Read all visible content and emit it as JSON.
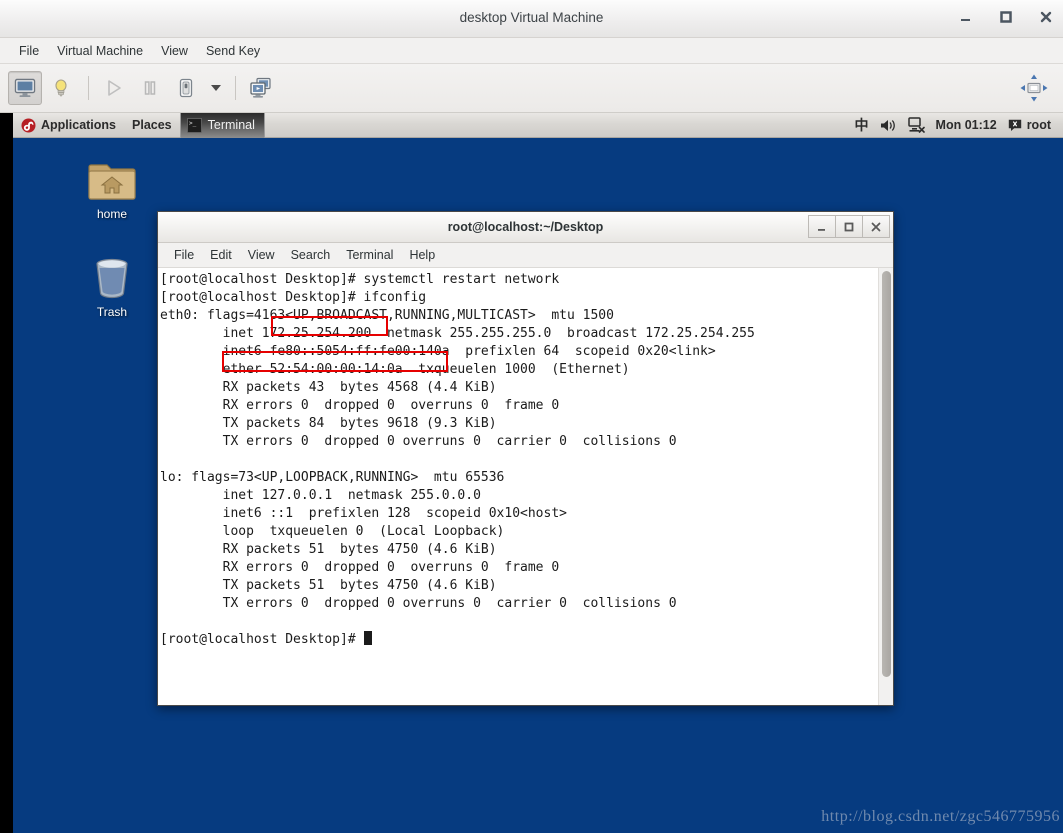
{
  "vm_window": {
    "title": "desktop Virtual Machine",
    "controls": [
      {
        "name": "minimize",
        "glyph": "minimize-icon"
      },
      {
        "name": "maximize",
        "glyph": "maximize-icon"
      },
      {
        "name": "close",
        "glyph": "close-icon"
      }
    ],
    "menus": [
      "File",
      "Virtual Machine",
      "View",
      "Send Key"
    ],
    "toolbar": {
      "console_label": "Show the graphical console",
      "details_label": "Show virtual hardware details",
      "run_label": "Run",
      "pause_label": "Pause",
      "shutdown_label": "Shut down",
      "shutdown_caret_label": "Shut down options",
      "snapshot_label": "Manage VM snapshots",
      "fullscreen_label": "Resize guest display"
    }
  },
  "guest": {
    "desktop_color": "#063b80",
    "panel": {
      "applications": "Applications",
      "places": "Places",
      "task_window": "Terminal",
      "input_method": "中",
      "clock": "Mon 01:12",
      "user": "root"
    },
    "desktop_icons": [
      {
        "name": "home",
        "label": "home"
      },
      {
        "name": "trash",
        "label": "Trash"
      }
    ]
  },
  "terminal": {
    "title": "root@localhost:~/Desktop",
    "menus": [
      "File",
      "Edit",
      "View",
      "Search",
      "Terminal",
      "Help"
    ],
    "window_controls": [
      "minimize",
      "maximize",
      "close"
    ],
    "lines": [
      "[root@localhost Desktop]# systemctl restart network",
      "[root@localhost Desktop]# ifconfig",
      "eth0: flags=4163<UP,BROADCAST,RUNNING,MULTICAST>  mtu 1500",
      "        inet 172.25.254.200  netmask 255.255.255.0  broadcast 172.25.254.255",
      "        inet6 fe80::5054:ff:fe00:140a  prefixlen 64  scopeid 0x20<link>",
      "        ether 52:54:00:00:14:0a  txqueuelen 1000  (Ethernet)",
      "        RX packets 43  bytes 4568 (4.4 KiB)",
      "        RX errors 0  dropped 0  overruns 0  frame 0",
      "        TX packets 84  bytes 9618 (9.3 KiB)",
      "        TX errors 0  dropped 0 overruns 0  carrier 0  collisions 0",
      "",
      "lo: flags=73<UP,LOOPBACK,RUNNING>  mtu 65536",
      "        inet 127.0.0.1  netmask 255.0.0.0",
      "        inet6 ::1  prefixlen 128  scopeid 0x10<host>",
      "        loop  txqueuelen 0  (Local Loopback)",
      "        RX packets 51  bytes 4750 (4.6 KiB)",
      "        RX errors 0  dropped 0  overruns 0  frame 0",
      "        TX packets 51  bytes 4750 (4.6 KiB)",
      "        TX errors 0  dropped 0 overruns 0  carrier 0  collisions 0",
      "",
      "[root@localhost Desktop]# "
    ],
    "prompt": "[root@localhost Desktop]# "
  },
  "annotations": {
    "color": "#e60000",
    "boxes": [
      {
        "name": "ipv4-address-highlight",
        "text": "172.25.254.200"
      },
      {
        "name": "mac-address-highlight",
        "text": "ether 52:54:00:00:14:0a"
      }
    ]
  },
  "watermark": {
    "text": "http://blog.csdn.net/zgc546775956"
  }
}
